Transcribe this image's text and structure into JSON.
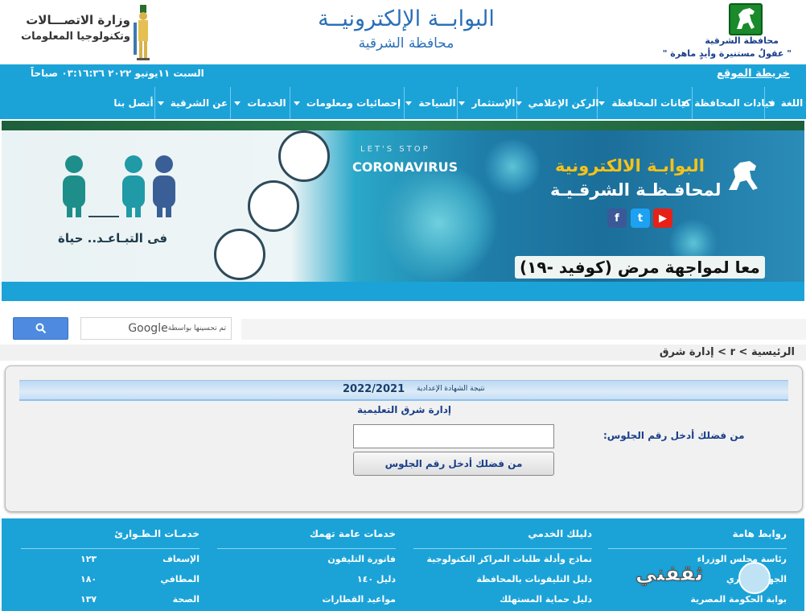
{
  "header": {
    "gov_name": "محافظة الشرقية",
    "gov_slogan": "\" عقولٌ مستنيرة وأيدٍ ماهرة \"",
    "portal_title": "البوابــة الإلكترونيــة",
    "portal_subtitle": "محافظة الشرقية",
    "ministry_line1": "وزارة الاتصـــالات",
    "ministry_line2": "وتكنولوجيا المعلومات"
  },
  "topbar": {
    "sitemap": "خريطة الموقع",
    "datetime": "السبت ١١يونيو ٢٠٢٢ ٠٣:١٦:٣٦ صباحاً"
  },
  "nav": {
    "items": [
      {
        "label": "اللغة",
        "has_menu": true
      },
      {
        "label": "قيادات المحافظة",
        "has_menu": true
      },
      {
        "label": "كيانات المحافظة",
        "has_menu": true
      },
      {
        "label": "الركن الإعلامي",
        "has_menu": true
      },
      {
        "label": "الإستثمار",
        "has_menu": true
      },
      {
        "label": "السياحة",
        "has_menu": true
      },
      {
        "label": "إحصائيات ومعلومات",
        "has_menu": true
      },
      {
        "label": "الخدمات",
        "has_menu": true
      },
      {
        "label": "عن الشرقية",
        "has_menu": true
      },
      {
        "label": "أتصل بنا",
        "has_menu": false
      }
    ]
  },
  "banner": {
    "stop_line1": "LET'S STOP",
    "stop_line2": "CORONAVIRUS",
    "title1": "البوابـة الالكترونية",
    "title2": "لمحافـظـة الشرقـيـة",
    "slogan": "معا لمواجهة مرض (كوفيد -١٩)",
    "distance_text": "فى التبـاعـد.. حياة",
    "social_fb": "f",
    "social_tw": "t",
    "social_yt": "▶"
  },
  "search": {
    "powered_by": "تم تحسينها بواسطة",
    "brand": "Google"
  },
  "breadcrumb": {
    "text": "الرئيسية > r > إدارة شرق"
  },
  "result": {
    "head_label": "نتيجة الشهادة الإعدادية",
    "head_year": "2022/2021",
    "admin_name": "إدارة شرق التعليمية",
    "seat_label": "من فضلك أدخل رقم الجلوس:",
    "seat_value": "",
    "submit_label": "من فضلك أدخل رقم الجلوس"
  },
  "footer": {
    "columns": [
      {
        "title": "روابط هامة",
        "rows": [
          [
            "رئاسة مجلس الوزراء",
            ""
          ],
          [
            "الجهاز الإداري",
            ""
          ],
          [
            "بوابة الحكومة المصرية",
            ""
          ]
        ]
      },
      {
        "title": "دليلك الخدمي",
        "rows": [
          [
            "نماذج وأدلة طلبات المراكز التكنولوجية",
            ""
          ],
          [
            "دليل التليفونات بالمحافظة",
            ""
          ],
          [
            "دليل حماية المستهلك",
            ""
          ]
        ]
      },
      {
        "title": "خدمات عامة تهمك",
        "rows": [
          [
            "فاتورة التليفون",
            ""
          ],
          [
            "دليل ١٤٠",
            ""
          ],
          [
            "مواعيد القطارات",
            ""
          ]
        ]
      },
      {
        "title": "خدمـات الـطـوارئ",
        "rows": [
          [
            "الإسعاف",
            "١٢٣"
          ],
          [
            "المطافي",
            "١٨٠"
          ],
          [
            "الصحة",
            "١٣٧"
          ]
        ]
      }
    ],
    "watermark": "ثقفني"
  }
}
